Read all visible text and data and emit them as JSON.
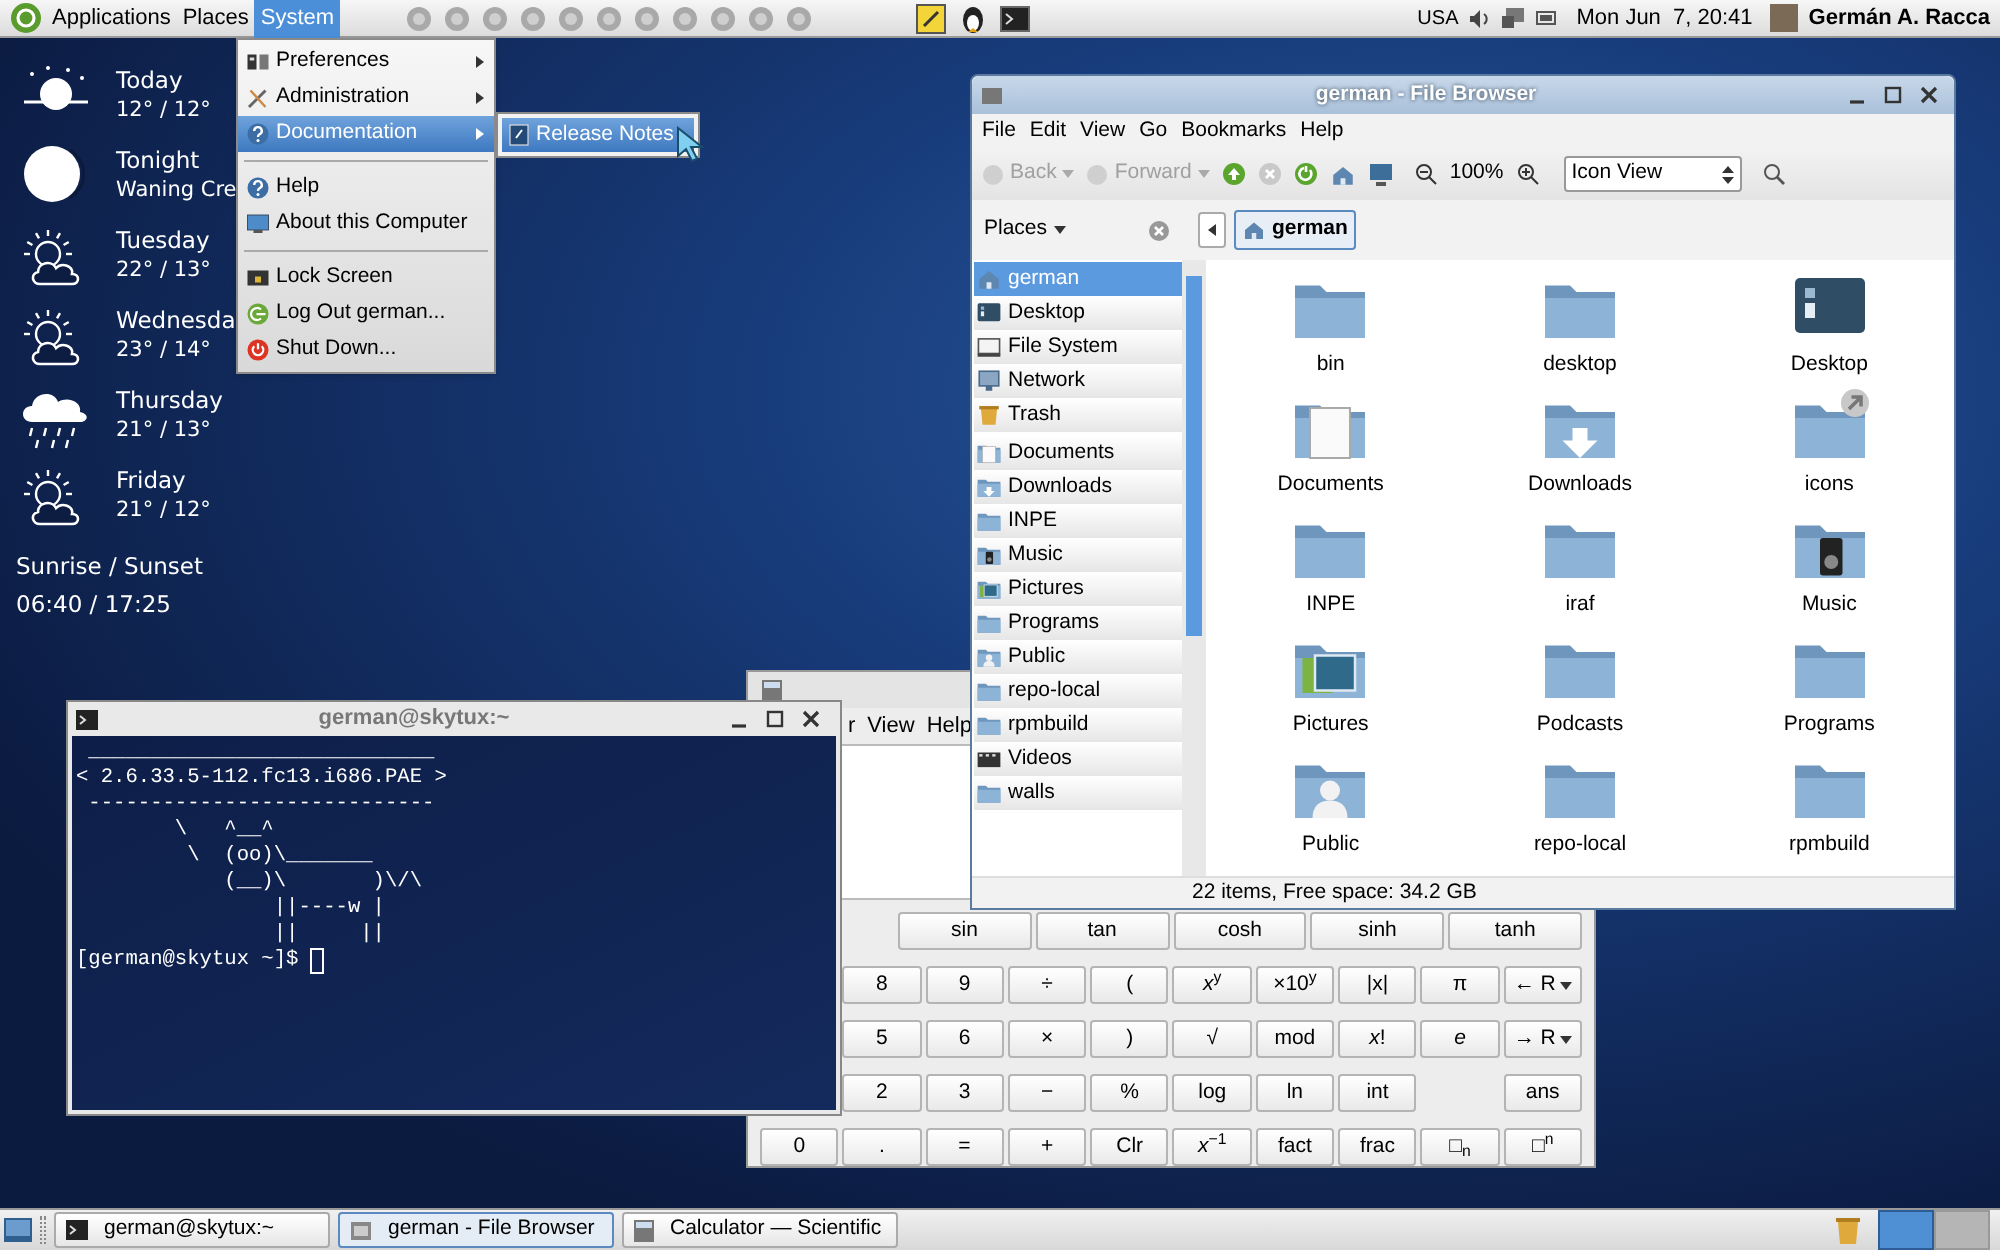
{
  "top_panel": {
    "menus": [
      {
        "label": "Applications",
        "selected": false
      },
      {
        "label": "Places",
        "selected": false
      },
      {
        "label": "System",
        "selected": true
      }
    ],
    "keyboard_layout": "USA",
    "clock": "Mon Jun  7, 20:41",
    "user": "Germán A. Racca"
  },
  "weather": {
    "days": [
      {
        "kind": "sun",
        "name": "Today",
        "detail": "12° / 12°"
      },
      {
        "kind": "moon",
        "name": "Tonight",
        "detail": "Waning Cre"
      },
      {
        "kind": "partly_cloudy",
        "name": "Tuesday",
        "detail": "22° / 13°"
      },
      {
        "kind": "partly_cloudy",
        "name": "Wednesda",
        "detail": "23° / 14°"
      },
      {
        "kind": "rain",
        "name": "Thursday",
        "detail": "21° / 13°"
      },
      {
        "kind": "partly_cloudy",
        "name": "Friday",
        "detail": "21° / 12°"
      }
    ],
    "sun_label": "Sunrise / Sunset",
    "sun_times": "06:40 / 17:25"
  },
  "system_menu": {
    "items": [
      {
        "kind": "item",
        "label": "Preferences",
        "submenu": true,
        "selected": false
      },
      {
        "kind": "item",
        "label": "Administration",
        "submenu": true,
        "selected": false
      },
      {
        "kind": "item",
        "label": "Documentation",
        "submenu": true,
        "selected": true
      },
      {
        "kind": "separator"
      },
      {
        "kind": "item",
        "label": "Help",
        "submenu": false,
        "selected": false
      },
      {
        "kind": "item",
        "label": "About this Computer",
        "submenu": false,
        "selected": false
      },
      {
        "kind": "separator"
      },
      {
        "kind": "item",
        "label": "Lock Screen",
        "submenu": false,
        "selected": false
      },
      {
        "kind": "item",
        "label": "Log Out german...",
        "submenu": false,
        "selected": false
      },
      {
        "kind": "item",
        "label": "Shut Down...",
        "submenu": false,
        "selected": false
      }
    ]
  },
  "submenu": {
    "items": [
      {
        "label": "Release Notes",
        "selected": true
      }
    ]
  },
  "file_browser": {
    "title": "german - File Browser",
    "menus": [
      "File",
      "Edit",
      "View",
      "Go",
      "Bookmarks",
      "Help"
    ],
    "back": {
      "label": "Back",
      "disabled": true
    },
    "forward": {
      "label": "Forward",
      "disabled": true
    },
    "zoom": "100%",
    "view_select": "Icon View",
    "places_label": "Places",
    "path": [
      {
        "label": "german",
        "selected": true
      }
    ],
    "sidebar": [
      {
        "kind": "home",
        "label": "german",
        "selected": true
      },
      {
        "kind": "desktop",
        "label": "Desktop",
        "selected": false
      },
      {
        "kind": "drive",
        "label": "File System",
        "selected": false
      },
      {
        "kind": "network",
        "label": "Network",
        "selected": false
      },
      {
        "kind": "trash",
        "label": "Trash",
        "selected": false
      }
    ],
    "bookmarks": [
      {
        "kind": "documents",
        "label": "Documents",
        "selected": false
      },
      {
        "kind": "downloads",
        "label": "Downloads",
        "selected": false
      },
      {
        "kind": "folder",
        "label": "INPE",
        "selected": false
      },
      {
        "kind": "music",
        "label": "Music",
        "selected": false
      },
      {
        "kind": "pictures",
        "label": "Pictures",
        "selected": false
      },
      {
        "kind": "folder",
        "label": "Programs",
        "selected": false
      },
      {
        "kind": "public",
        "label": "Public",
        "selected": false
      },
      {
        "kind": "folder",
        "label": "repo-local",
        "selected": false
      },
      {
        "kind": "folder",
        "label": "rpmbuild",
        "selected": false
      },
      {
        "kind": "videos",
        "label": "Videos",
        "selected": false
      },
      {
        "kind": "folder",
        "label": "walls",
        "selected": false
      }
    ],
    "files": [
      {
        "kind": "folder",
        "name": "bin"
      },
      {
        "kind": "folder",
        "name": "desktop"
      },
      {
        "kind": "desktop",
        "name": "Desktop"
      },
      {
        "kind": "documents",
        "name": "Documents"
      },
      {
        "kind": "downloads",
        "name": "Downloads"
      },
      {
        "kind": "link",
        "name": "icons"
      },
      {
        "kind": "folder",
        "name": "INPE"
      },
      {
        "kind": "folder",
        "name": "iraf"
      },
      {
        "kind": "music",
        "name": "Music"
      },
      {
        "kind": "pictures",
        "name": "Pictures"
      },
      {
        "kind": "folder",
        "name": "Podcasts"
      },
      {
        "kind": "folder",
        "name": "Programs"
      },
      {
        "kind": "public",
        "name": "Public"
      },
      {
        "kind": "folder",
        "name": "repo-local"
      },
      {
        "kind": "folder",
        "name": "rpmbuild"
      }
    ],
    "status": "22 items, Free space: 34.2 GB"
  },
  "terminal": {
    "title": "german@skytux:~",
    "lines": [
      " ____________________________",
      "< 2.6.33.5-112.fc13.i686.PAE >",
      " ----------------------------",
      "        \\   ^__^",
      "         \\  (oo)\\_______",
      "            (__)\\       )\\/\\",
      "                ||----w |",
      "                ||     ||"
    ],
    "prompt": "[german@skytux ~]$ "
  },
  "calculator": {
    "menus": [
      "r",
      "View",
      "Help"
    ],
    "function_row": [
      "sin",
      "tan",
      "cosh",
      "sinh",
      "tanh"
    ],
    "rows": [
      [
        null,
        {
          "kind": "key",
          "label": "8"
        },
        {
          "kind": "key",
          "label": "9"
        },
        {
          "kind": "key",
          "label": "÷"
        },
        {
          "kind": "key",
          "label": "("
        },
        {
          "kind": "key",
          "label": "*x*$^{y}$"
        },
        {
          "kind": "key",
          "label": "×10$^{y}$"
        },
        {
          "kind": "key",
          "label": "|x|"
        },
        {
          "kind": "key",
          "label": "π"
        },
        {
          "kind": "menu",
          "label": "← R"
        }
      ],
      [
        null,
        {
          "kind": "key",
          "label": "5"
        },
        {
          "kind": "key",
          "label": "6"
        },
        {
          "kind": "key",
          "label": "×"
        },
        {
          "kind": "key",
          "label": ")"
        },
        {
          "kind": "key",
          "label": "√"
        },
        {
          "kind": "key",
          "label": "mod"
        },
        {
          "kind": "key",
          "label": "*x*!"
        },
        {
          "kind": "key",
          "label": "*e*"
        },
        {
          "kind": "menu",
          "label": "→ R"
        }
      ],
      [
        null,
        {
          "kind": "key",
          "label": "2"
        },
        {
          "kind": "key",
          "label": "3"
        },
        {
          "kind": "key",
          "label": "−"
        },
        {
          "kind": "key",
          "label": "%"
        },
        {
          "kind": "key",
          "label": "log"
        },
        {
          "kind": "key",
          "label": "ln"
        },
        {
          "kind": "key",
          "label": "int"
        },
        null,
        {
          "kind": "key",
          "label": "ans"
        }
      ],
      [
        {
          "kind": "key",
          "label": "0"
        },
        {
          "kind": "key",
          "label": "."
        },
        {
          "kind": "key",
          "label": "="
        },
        {
          "kind": "key",
          "label": "+"
        },
        {
          "kind": "key",
          "label": "Clr"
        },
        {
          "kind": "key",
          "label": "*x*$^{−1}$"
        },
        {
          "kind": "key",
          "label": "fact"
        },
        {
          "kind": "key",
          "label": "frac"
        },
        {
          "kind": "key",
          "label": "□$_{n}$"
        },
        {
          "kind": "key",
          "label": "□$^{n}$"
        }
      ]
    ]
  },
  "taskbar": {
    "tasks": [
      {
        "label": "german@skytux:~",
        "selected": false
      },
      {
        "label": "german - File Browser",
        "selected": true
      },
      {
        "label": "Calculator — Scientific",
        "selected": false
      }
    ]
  }
}
